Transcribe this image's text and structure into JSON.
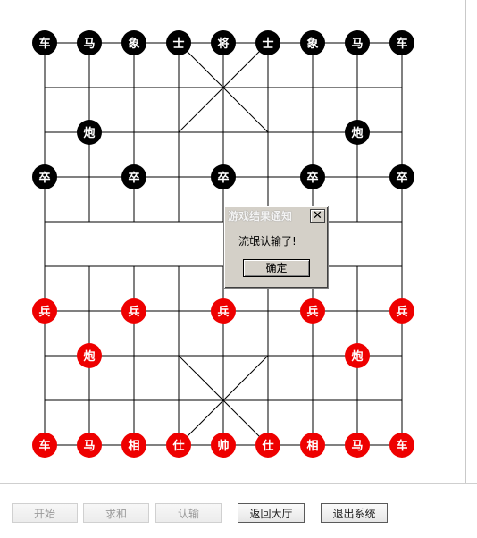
{
  "board": {
    "pieces": [
      {
        "side": "black",
        "label": "车",
        "col": 0,
        "row": 0
      },
      {
        "side": "black",
        "label": "马",
        "col": 1,
        "row": 0
      },
      {
        "side": "black",
        "label": "象",
        "col": 2,
        "row": 0
      },
      {
        "side": "black",
        "label": "士",
        "col": 3,
        "row": 0
      },
      {
        "side": "black",
        "label": "将",
        "col": 4,
        "row": 0
      },
      {
        "side": "black",
        "label": "士",
        "col": 5,
        "row": 0
      },
      {
        "side": "black",
        "label": "象",
        "col": 6,
        "row": 0
      },
      {
        "side": "black",
        "label": "马",
        "col": 7,
        "row": 0
      },
      {
        "side": "black",
        "label": "车",
        "col": 8,
        "row": 0
      },
      {
        "side": "black",
        "label": "炮",
        "col": 1,
        "row": 2
      },
      {
        "side": "black",
        "label": "炮",
        "col": 7,
        "row": 2
      },
      {
        "side": "black",
        "label": "卒",
        "col": 0,
        "row": 3
      },
      {
        "side": "black",
        "label": "卒",
        "col": 2,
        "row": 3
      },
      {
        "side": "black",
        "label": "卒",
        "col": 4,
        "row": 3
      },
      {
        "side": "black",
        "label": "卒",
        "col": 6,
        "row": 3
      },
      {
        "side": "black",
        "label": "卒",
        "col": 8,
        "row": 3
      },
      {
        "side": "red",
        "label": "兵",
        "col": 0,
        "row": 6
      },
      {
        "side": "red",
        "label": "兵",
        "col": 2,
        "row": 6
      },
      {
        "side": "red",
        "label": "兵",
        "col": 4,
        "row": 6
      },
      {
        "side": "red",
        "label": "兵",
        "col": 6,
        "row": 6
      },
      {
        "side": "red",
        "label": "兵",
        "col": 8,
        "row": 6
      },
      {
        "side": "red",
        "label": "炮",
        "col": 1,
        "row": 7
      },
      {
        "side": "red",
        "label": "炮",
        "col": 7,
        "row": 7
      },
      {
        "side": "red",
        "label": "车",
        "col": 0,
        "row": 9
      },
      {
        "side": "red",
        "label": "马",
        "col": 1,
        "row": 9
      },
      {
        "side": "red",
        "label": "相",
        "col": 2,
        "row": 9
      },
      {
        "side": "red",
        "label": "仕",
        "col": 3,
        "row": 9
      },
      {
        "side": "red",
        "label": "帅",
        "col": 4,
        "row": 9
      },
      {
        "side": "red",
        "label": "仕",
        "col": 5,
        "row": 9
      },
      {
        "side": "red",
        "label": "相",
        "col": 6,
        "row": 9
      },
      {
        "side": "red",
        "label": "马",
        "col": 7,
        "row": 9
      },
      {
        "side": "red",
        "label": "车",
        "col": 8,
        "row": 9
      }
    ],
    "colors": {
      "black_piece": "#000000",
      "red_piece": "#ee0000",
      "piece_text": "#ffffff",
      "grid": "#000000"
    }
  },
  "dialog": {
    "title": "游戏结果通知",
    "close_glyph": "✕",
    "message": "流氓认输了!",
    "ok_label": "确定"
  },
  "toolbar": {
    "start_label": "开始",
    "draw_label": "求和",
    "resign_label": "认输",
    "lobby_label": "返回大厅",
    "exit_label": "退出系统"
  }
}
